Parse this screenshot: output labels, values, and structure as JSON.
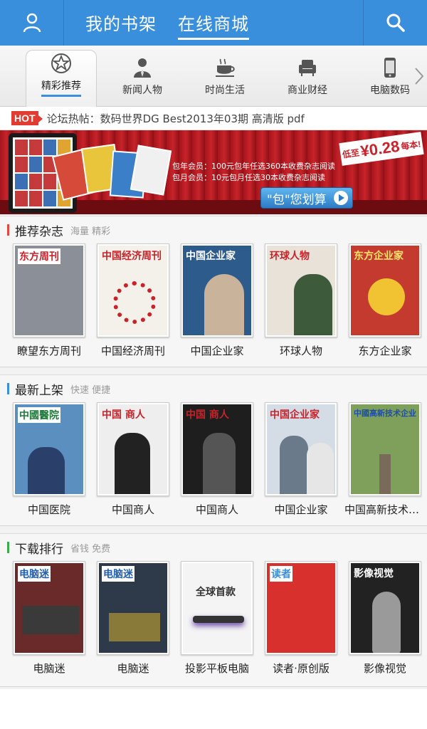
{
  "header": {
    "tabs": [
      {
        "label": "我的书架"
      },
      {
        "label": "在线商城"
      }
    ],
    "colors": {
      "bar": "#3a8fdc"
    }
  },
  "categories": [
    {
      "label": "精彩推荐",
      "icon": "star-icon",
      "active": true
    },
    {
      "label": "新闻人物",
      "icon": "person-icon"
    },
    {
      "label": "时尚生活",
      "icon": "coffee-cup-icon"
    },
    {
      "label": "商业财经",
      "icon": "armchair-icon"
    },
    {
      "label": "电脑数码",
      "icon": "phone-icon"
    }
  ],
  "hot": {
    "badge": "HOT",
    "text": "论坛热帖：数码世界DG Best2013年03期 高清版 pdf"
  },
  "banner": {
    "line1": "包年会员：100元包年任选360本收费杂志阅读",
    "line2": "包月会员：10元包月任选30本收费杂志阅读",
    "price_prefix": "低至",
    "price": "¥0.28",
    "price_suffix": "每本!",
    "cta": "\"包\"您划算"
  },
  "sections": [
    {
      "title": "推荐杂志",
      "subtitle": "海量 精彩",
      "accent": "#e2483d",
      "books": [
        {
          "title": "瞭望东方周刊",
          "mast": "东方周刊",
          "bg": "#8a8f98",
          "fg": "#c8232a"
        },
        {
          "title": "中国经济周刊",
          "mast": "中国经济周刊",
          "bg": "#f4f1ea",
          "fg": "#c8232a"
        },
        {
          "title": "中国企业家",
          "mast": "中国企业家",
          "bg": "#2d5b8c",
          "fg": "#ffffff"
        },
        {
          "title": "环球人物",
          "mast": "环球人物",
          "bg": "#e8e2d8",
          "fg": "#c8232a"
        },
        {
          "title": "东方企业家",
          "mast": "东方企业家",
          "bg": "#c43a2e",
          "fg": "#ffe36a"
        }
      ]
    },
    {
      "title": "最新上架",
      "subtitle": "快速 便捷",
      "accent": "#3a8fdc",
      "books": [
        {
          "title": "中国医院",
          "mast": "中國醫院",
          "bg": "#5b8fbf",
          "fg": "#1f7a3a"
        },
        {
          "title": "中国商人",
          "mast": "中国 商人",
          "bg": "#eeeeee",
          "fg": "#c8232a"
        },
        {
          "title": "中国商人",
          "mast": "中国 商人",
          "bg": "#1e1e1e",
          "fg": "#c8232a"
        },
        {
          "title": "中国企业家",
          "mast": "中国企业家",
          "bg": "#d4dce6",
          "fg": "#c8232a"
        },
        {
          "title": "中国高新技术企业",
          "mast": "中國高新技术企业",
          "bg": "#7ea05b",
          "fg": "#1e4fa3"
        }
      ]
    },
    {
      "title": "下载排行",
      "subtitle": "省钱 免费",
      "accent": "#3aaa4a",
      "books": [
        {
          "title": "电脑迷",
          "mast": "电脑迷",
          "bg": "#6a2a2a",
          "fg": "#1e5fb0"
        },
        {
          "title": "电脑迷",
          "mast": "电脑迷",
          "bg": "#2e3a4a",
          "fg": "#1e5fb0"
        },
        {
          "title": "投影平板电脑",
          "mast": "全球首款",
          "bg": "#f4f4f4",
          "fg": "#333333"
        },
        {
          "title": "读者·原创版",
          "mast": "读者",
          "bg": "#d8302c",
          "fg": "#3a8fdc"
        },
        {
          "title": "影像视觉",
          "mast": "影像视觉",
          "bg": "#222222",
          "fg": "#ffffff"
        }
      ]
    }
  ]
}
